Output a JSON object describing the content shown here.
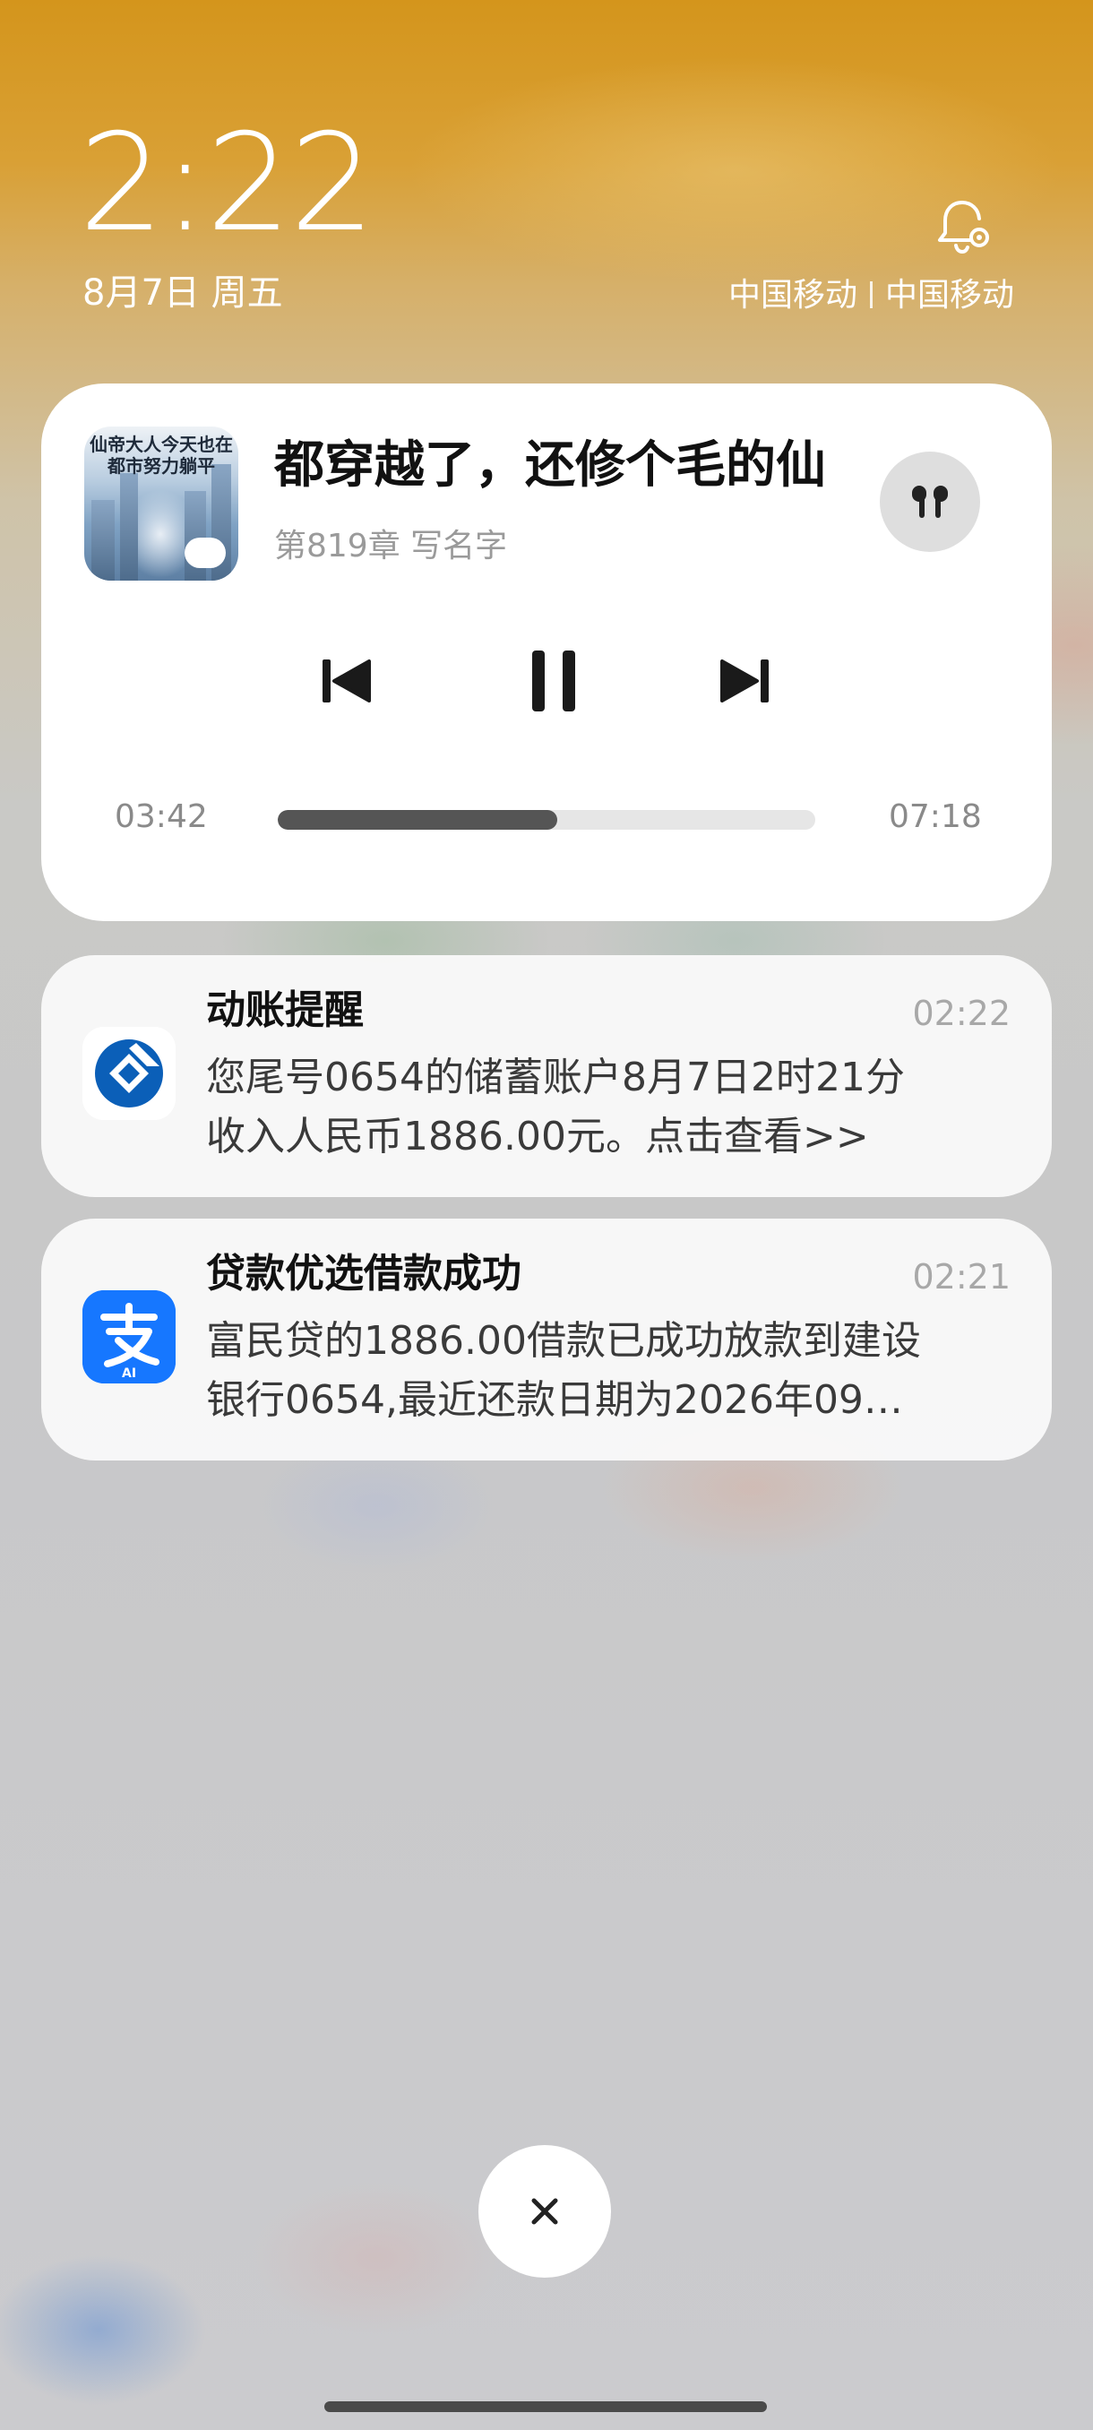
{
  "status": {
    "time": "2:22",
    "date": "8月7日 周五",
    "carrier_1": "中国移动",
    "carrier_2": "中国移动"
  },
  "media": {
    "cover_title": "仙帝大人今天也在都市努力躺平",
    "title": "都穿越了，还修个毛的仙",
    "subtitle": "第819章 写名字",
    "elapsed": "03:42",
    "total": "07:18",
    "progress_fraction": 0.52,
    "output_icon": "earbuds-icon"
  },
  "notifications": [
    {
      "app_icon": "ccb-bank-icon",
      "title": "动账提醒",
      "time": "02:22",
      "body_line1": "您尾号0654的储蓄账户8月7日2时21分",
      "body_line2": "收入人民币1886.00元。点击查看>>"
    },
    {
      "app_icon": "alipay-icon",
      "title": "贷款优选借款成功",
      "time": "02:21",
      "body_line1": "富民贷的1886.00借款已成功放款到建设",
      "body_line2": "银行0654,最近还款日期为2026年09…",
      "icon_badge": "AI"
    }
  ],
  "colors": {
    "alipay_blue": "#1677ff",
    "ccb_blue": "#0b5fb8"
  }
}
